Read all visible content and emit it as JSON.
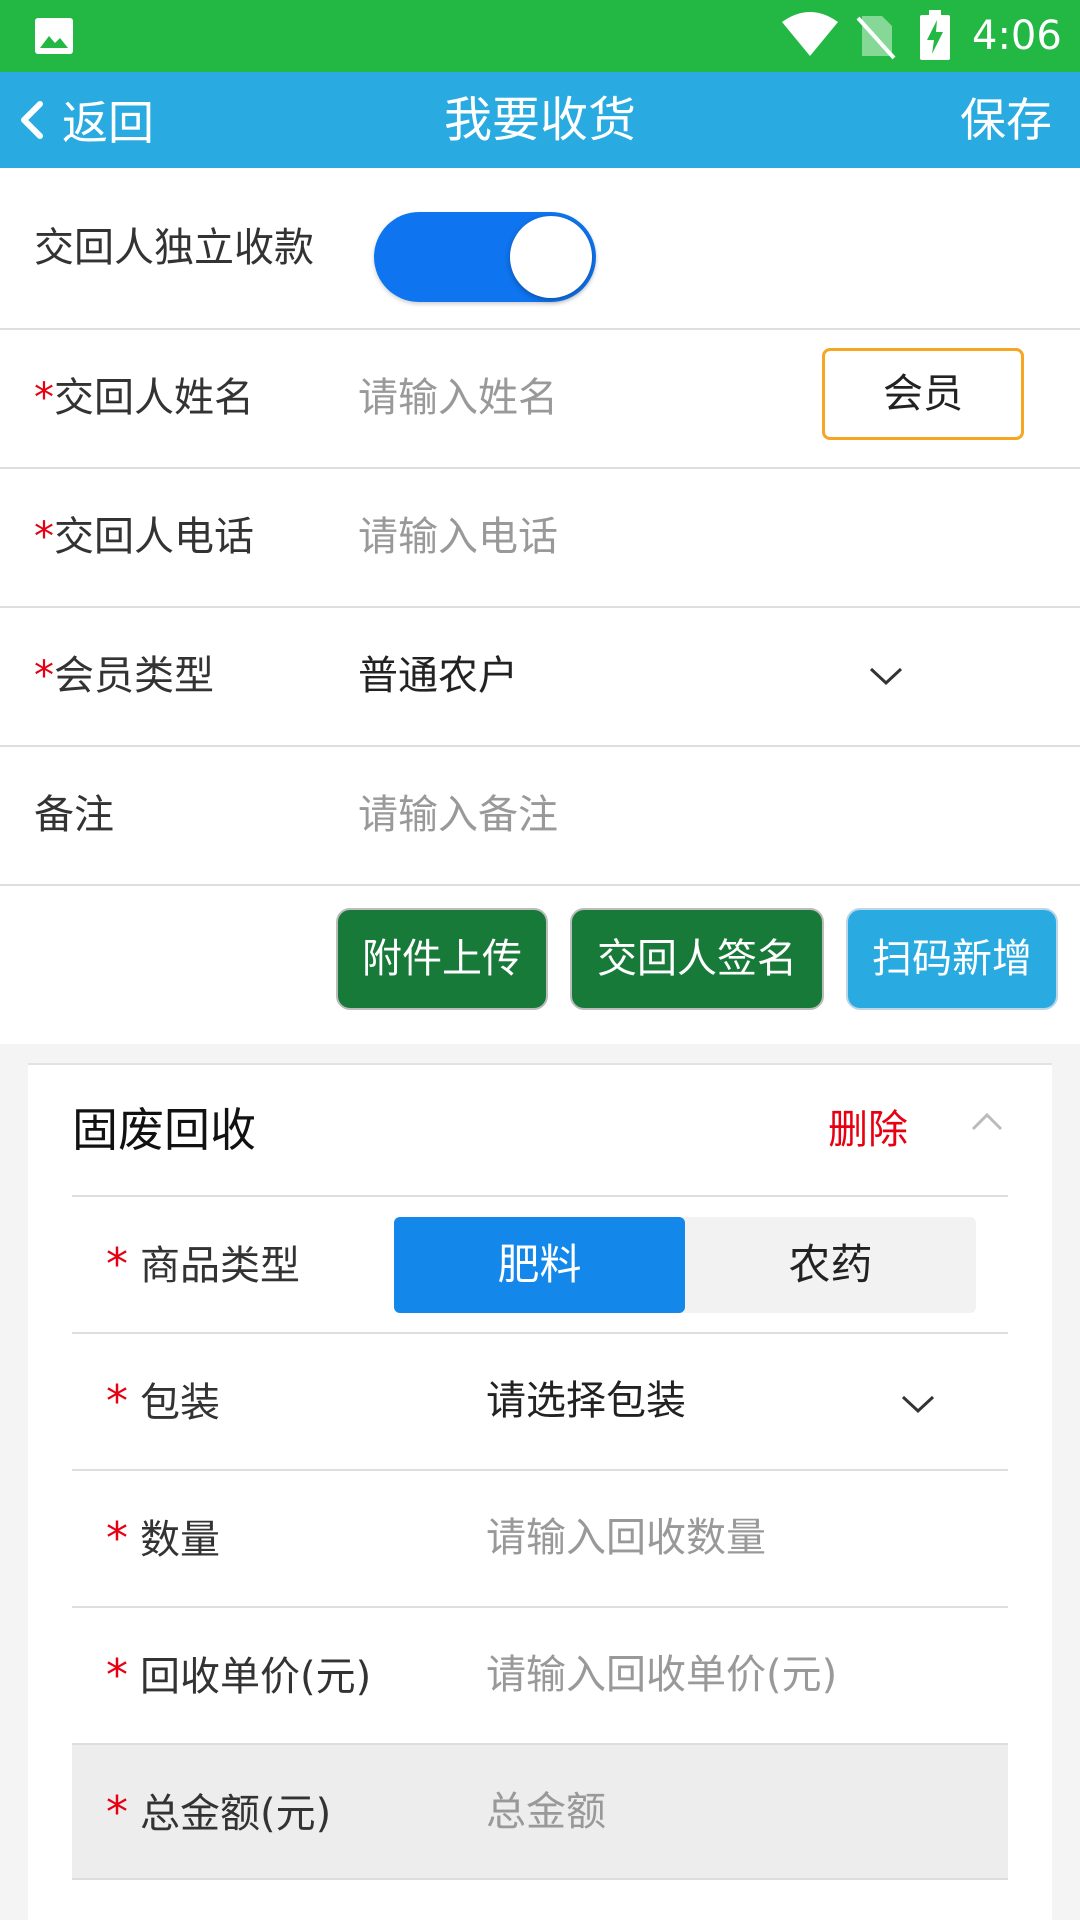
{
  "status_bar": {
    "time": "4:06",
    "icons": [
      "image-icon",
      "wifi-icon",
      "no-sim-icon",
      "battery-charging-icon"
    ]
  },
  "app_bar": {
    "back_label": "返回",
    "title": "我要收货",
    "save_label": "保存"
  },
  "form": {
    "independent_payment": {
      "label": "交回人独立收款",
      "enabled": true
    },
    "name": {
      "required": "*",
      "label": "交回人姓名",
      "placeholder": "请输入姓名",
      "member_button": "会员"
    },
    "phone": {
      "required": "*",
      "label": "交回人电话",
      "placeholder": "请输入电话"
    },
    "member_type": {
      "required": "*",
      "label": "会员类型",
      "value": "普通农户"
    },
    "remark": {
      "label": "备注",
      "placeholder": "请输入备注"
    }
  },
  "actions": {
    "attachment_upload": "附件上传",
    "signature": "交回人签名",
    "scan_add": "扫码新增"
  },
  "colors": {
    "status_bar": "#23b843",
    "app_bar": "#29abe2",
    "toggle_on": "#0f74f0",
    "required_star": "#e60012",
    "member_button_border": "#f5a623",
    "green_button": "#177a39",
    "segment_active": "#1388ea"
  },
  "card": {
    "title": "固废回收",
    "delete_label": "删除",
    "product_type": {
      "required": "*",
      "label": "商品类型",
      "options": [
        "肥料",
        "农药"
      ],
      "selected": "肥料"
    },
    "packaging": {
      "required": "*",
      "label": "包装",
      "placeholder": "请选择包装"
    },
    "quantity": {
      "required": "*",
      "label": "数量",
      "placeholder": "请输入回收数量"
    },
    "unit_price": {
      "required": "*",
      "label": "回收单价(元)",
      "placeholder": "请输入回收单价(元)"
    },
    "total": {
      "required": "*",
      "label": "总金额(元)",
      "placeholder": "总金额"
    }
  }
}
